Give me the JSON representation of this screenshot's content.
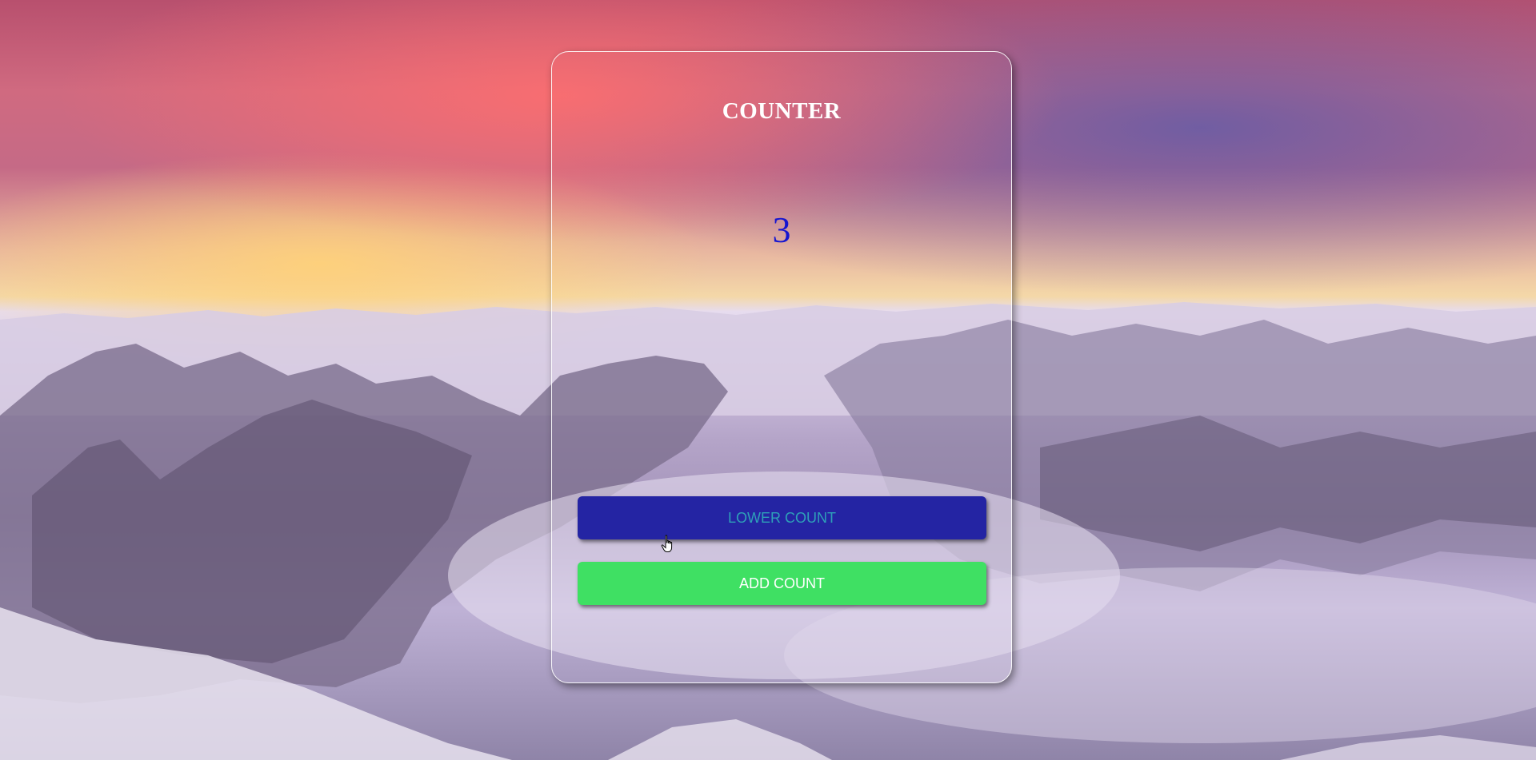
{
  "app": {
    "title": "COUNTER",
    "count_value": "3"
  },
  "buttons": {
    "lower_label": "LOWER COUNT",
    "add_label": "ADD COUNT"
  },
  "colors": {
    "count_text": "#1515d0",
    "lower_button_bg": "#2424a3",
    "lower_button_text": "#2ea0b8",
    "add_button_bg": "#3fe063",
    "add_button_text": "#ffffff"
  },
  "icons": {
    "cursor": "hand-pointer-icon"
  }
}
